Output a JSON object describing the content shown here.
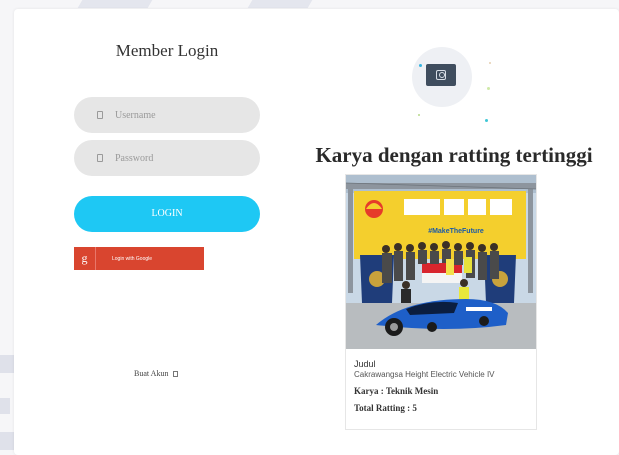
{
  "login": {
    "title": "Member Login",
    "username_placeholder": "Username",
    "password_placeholder": "Password",
    "login_button": "LOGIN",
    "google_icon_glyph": "g",
    "google_button": "Login with Google",
    "register_label": "Buat Akun"
  },
  "featured": {
    "heading": "Karya dengan ratting tertinggi",
    "judul_label": "Judul",
    "project_title": "Cakrawangsa Height Electric Vehicle IV",
    "karya_line": "Karya : Teknik Mesin",
    "rating_line": "Total Ratting : 5",
    "photo_banner_text": "#MakeTheFuture"
  },
  "colors": {
    "login_button": "#1ec8f4",
    "google_button": "#d9452f",
    "field_bg": "#e6e6e6",
    "banner_yellow": "#f4cf2d"
  },
  "icons": {
    "field_icon": "user-icon",
    "password_icon": "lock-icon",
    "register_icon": "pencil-icon",
    "header_icon": "monitor-user-icon"
  }
}
